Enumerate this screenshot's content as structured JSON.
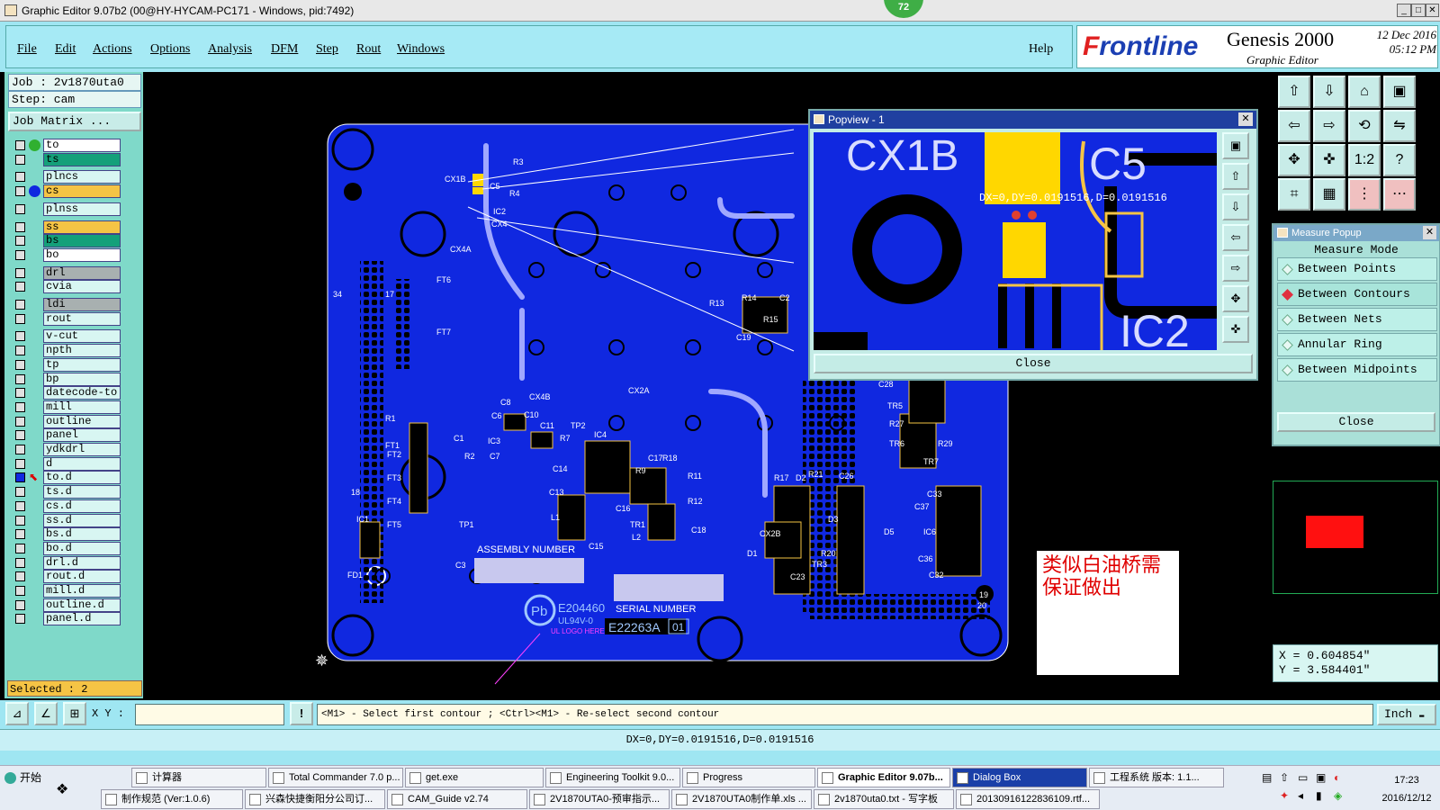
{
  "window": {
    "title": "Graphic Editor 9.07b2 (00@HY-HYCAM-PC171 - Windows, pid:7492)",
    "badge": "72"
  },
  "menu": {
    "items": [
      "File",
      "Edit",
      "Actions",
      "Options",
      "Analysis",
      "DFM",
      "Step",
      "Rout",
      "Windows"
    ],
    "help": "Help"
  },
  "brand": {
    "logo_f": "F",
    "logo_rest": "rontline",
    "product": "Genesis 2000",
    "subtitle": "Graphic Editor",
    "date": "12 Dec 2016",
    "time": "05:12 PM"
  },
  "job": {
    "job_line": "Job : 2v1870uta0",
    "step_line": "Step: cam",
    "matrix_button": "Job Matrix ..."
  },
  "layers": [
    {
      "name": "to",
      "color": "#ffffff",
      "active": true
    },
    {
      "name": "ts",
      "color": "#14a07a"
    },
    {
      "name": "plncs",
      "color": "#d8f6f2"
    },
    {
      "name": "cs",
      "color": "#f5c445",
      "active": true
    },
    {
      "name": "plnss",
      "color": "#d8f6f2"
    },
    {
      "name": "ss",
      "color": "#f5c445"
    },
    {
      "name": "bs",
      "color": "#14a07a"
    },
    {
      "name": "bo",
      "color": "#ffffff"
    },
    {
      "name": "drl",
      "color": "#a8b0b0"
    },
    {
      "name": "cvia",
      "color": "#d8f6f2"
    },
    {
      "name": "ldi",
      "color": "#a8b0b0"
    },
    {
      "name": "rout",
      "color": "#d8f6f2"
    },
    {
      "name": "v-cut",
      "color": "#d8f6f2"
    },
    {
      "name": "npth",
      "color": "#d8f6f2"
    },
    {
      "name": "tp",
      "color": "#d8f6f2"
    },
    {
      "name": "bp",
      "color": "#d8f6f2"
    },
    {
      "name": "datecode-to",
      "color": "#d8f6f2"
    },
    {
      "name": "mill",
      "color": "#d8f6f2"
    },
    {
      "name": "outline",
      "color": "#d8f6f2"
    },
    {
      "name": "panel",
      "color": "#d8f6f2"
    },
    {
      "name": "ydkdrl",
      "color": "#d8f6f2"
    },
    {
      "name": "d",
      "color": "#d8f6f2"
    },
    {
      "name": "to.d",
      "color": "#d8f6f2",
      "work": true
    },
    {
      "name": "ts.d",
      "color": "#d8f6f2"
    },
    {
      "name": "cs.d",
      "color": "#d8f6f2"
    },
    {
      "name": "ss.d",
      "color": "#d8f6f2"
    },
    {
      "name": "bs.d",
      "color": "#d8f6f2"
    },
    {
      "name": "bo.d",
      "color": "#d8f6f2"
    },
    {
      "name": "drl.d",
      "color": "#d8f6f2"
    },
    {
      "name": "rout.d",
      "color": "#d8f6f2"
    },
    {
      "name": "mill.d",
      "color": "#d8f6f2"
    },
    {
      "name": "outline.d",
      "color": "#d8f6f2"
    },
    {
      "name": "panel.d",
      "color": "#d8f6f2"
    }
  ],
  "selected": "Selected : 2",
  "board": {
    "labels": [
      "CX1B",
      "C5",
      "R3",
      "R4",
      "IC2",
      "CX4",
      "CX4A",
      "FT6",
      "FT7",
      "R13",
      "R14",
      "C2",
      "R15",
      "C19",
      "CX4B",
      "C8",
      "C6",
      "C10",
      "IC3",
      "C7",
      "R7",
      "TP2",
      "IC4",
      "C11",
      "C14",
      "C13",
      "R9",
      "C17",
      "R18",
      "R11",
      "R12",
      "C16",
      "TR1",
      "L2",
      "C18",
      "L1",
      "C15",
      "C1",
      "R2",
      "FT1",
      "FT2",
      "FT3",
      "FT4",
      "FT5",
      "TP1",
      "IC1",
      "R1",
      "FD1",
      "C3",
      "CX2A",
      "R17",
      "D2",
      "R21",
      "C26",
      "CX2B",
      "D1",
      "C23",
      "R20",
      "TR3",
      "D3",
      "C28",
      "TR5",
      "R27",
      "TR6",
      "R29",
      "TR7",
      "C33",
      "C37",
      "D5",
      "IC6",
      "C36",
      "C32",
      "34",
      "17",
      "18",
      "19",
      "20"
    ],
    "assembly": "ASSEMBLY NUMBER",
    "serial": "SERIAL NUMBER",
    "ul": "E204460",
    "ul2": "UL94V-0",
    "logo_here": "UL LOGO HERE",
    "code": "E22263A",
    "code2": "01",
    "pb": "Pb"
  },
  "note": {
    "line1": "类似白油桥需",
    "line2": "保证做出"
  },
  "popview": {
    "title": "Popview - 1",
    "measure_text": "DX=0,DY=0.0191516,D=0.0191516",
    "lbl1": "CX1B",
    "lbl2": "C5",
    "lbl3": "IC2",
    "close": "Close"
  },
  "measure_popup": {
    "title": "Measure Popup",
    "mode_label": "Measure Mode",
    "items": [
      "Between Points",
      "Between Contours",
      "Between Nets",
      "Annular Ring",
      "Between Midpoints"
    ],
    "close": "Close"
  },
  "coords": {
    "x": "X = 0.604854\"",
    "y": "Y = 3.584401\""
  },
  "cmd": {
    "xy_label": "X Y :",
    "input": "",
    "prompt": "<M1> - Select first contour ; <Ctrl><M1> - Re-select second contour",
    "unit": "Inch"
  },
  "status": "DX=0,DY=0.0191516,D=0.0191516",
  "taskbar": {
    "start": "开始",
    "row1": [
      "计算器",
      "Total Commander 7.0 p...",
      "get.exe",
      "Engineering Toolkit 9.0...",
      "Progress",
      "Graphic Editor 9.07b...",
      "Dialog Box",
      "工程系统  版本: 1.1..."
    ],
    "row2": [
      "制作规范 (Ver:1.0.6)",
      "兴森快捷衡阳分公司订...",
      "CAM_Guide v2.74",
      "2V1870UTA0-预审指示...",
      "2V1870UTA0制作单.xls ...",
      "2v1870uta0.txt - 写字板",
      "20130916122836109.rtf..."
    ],
    "clock_time": "17:23",
    "clock_date": "2016/12/12"
  }
}
